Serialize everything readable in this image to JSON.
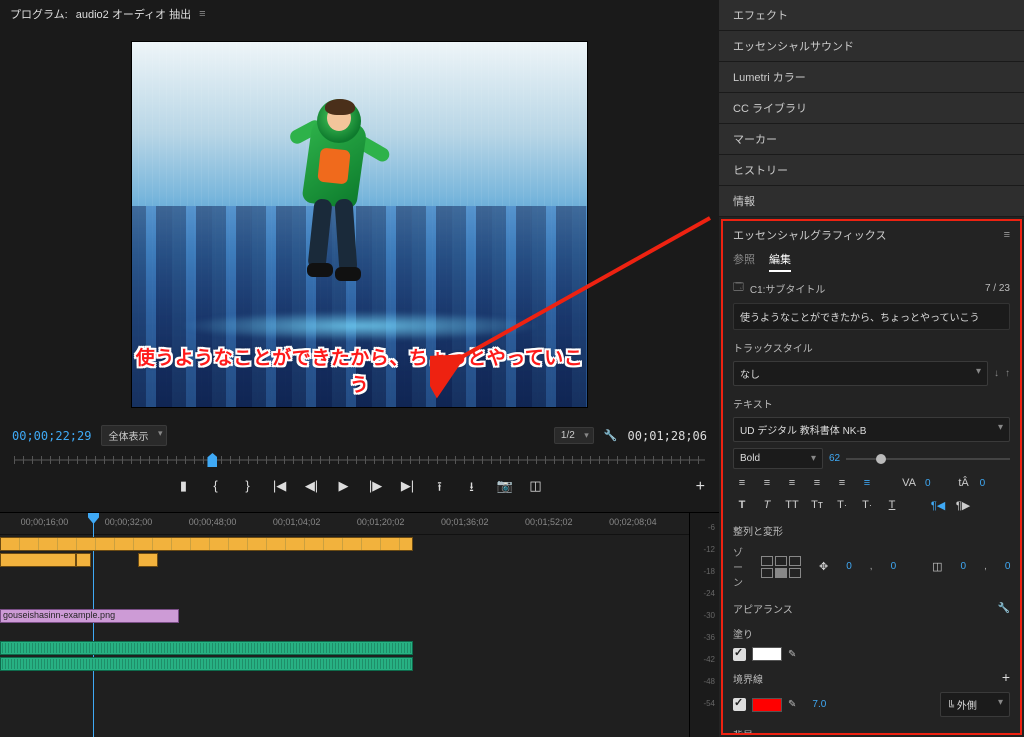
{
  "program": {
    "label": "プログラム:",
    "title": "audio2 オーディオ 抽出",
    "subtitle_text": "使うようなことができたから、ちょっとやっていこう",
    "current_tc": "00;00;22;29",
    "duration_tc": "00;01;28;06",
    "fit_label": "全体表示",
    "res_label": "1/2"
  },
  "timeline": {
    "ruler": [
      "00;00;16;00",
      "00;00;32;00",
      "00;00;48;00",
      "00;01;04;02",
      "00;01;20;02",
      "00;01;36;02",
      "00;01;52;02",
      "00;02;08;04"
    ],
    "playhead_pct": 13.5,
    "v1_clip_name": "gouseishasinn-example.png",
    "vu_marks": [
      "-6",
      "-12",
      "-18",
      "-24",
      "-30",
      "-36",
      "-42",
      "-48",
      "-54"
    ]
  },
  "panels": {
    "items": [
      "エフェクト",
      "エッセンシャルサウンド",
      "Lumetri カラー",
      "CC ライブラリ",
      "マーカー",
      "ヒストリー",
      "情報"
    ]
  },
  "eg": {
    "title": "エッセンシャルグラフィックス",
    "tab_browse": "参照",
    "tab_edit": "編集",
    "caption_track": "C1:サブタイトル",
    "caption_count": "7 / 23",
    "caption_text": "使うようなことができたから、ちょっとやっていこう",
    "trackstyle_label": "トラックスタイル",
    "trackstyle_value": "なし",
    "text_label": "テキスト",
    "font_name": "UD デジタル 教科書体 NK-B",
    "font_style": "Bold",
    "font_size": "62",
    "tracking": "0",
    "baseline": "0",
    "align_label": "整列と変形",
    "zone_label": "ゾーン",
    "pos_x": "0",
    "pos_y": "0",
    "scale_x": "0",
    "scale_y": "0",
    "appearance_label": "アピアランス",
    "fill_label": "塗り",
    "fill_color": "#ffffff",
    "stroke_label": "境界線",
    "stroke_color": "#ff0000",
    "stroke_width": "7.0",
    "stroke_pos": "外側",
    "bg_label": "背景"
  }
}
